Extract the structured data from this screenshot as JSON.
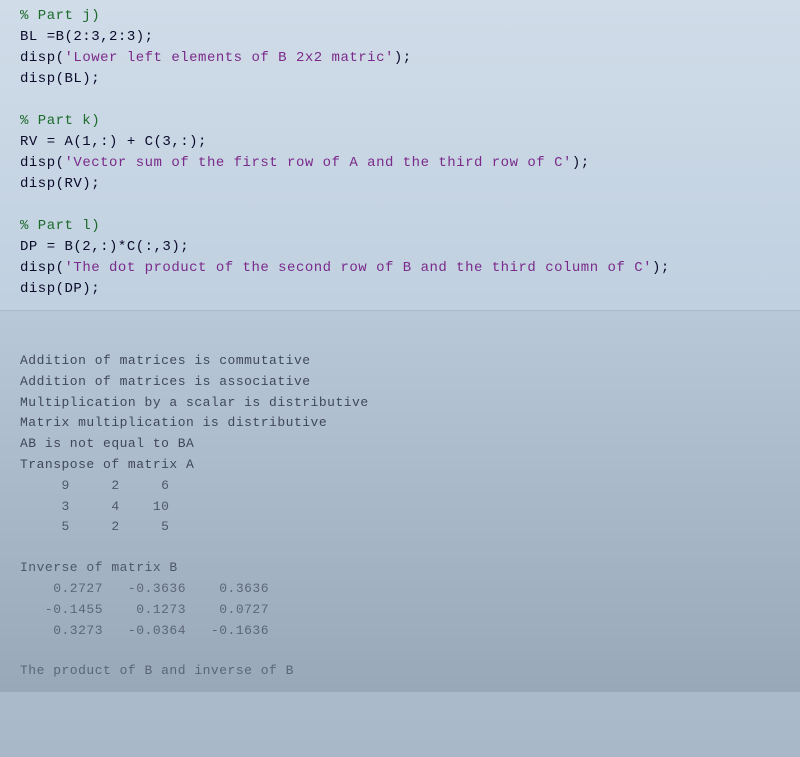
{
  "editor": {
    "part_j": {
      "comment": "% Part j)",
      "line1": "BL =B(2:3,2:3);",
      "line2_prefix": "disp(",
      "line2_string": "'Lower left elements of B 2x2 matric'",
      "line2_suffix": ");",
      "line3": "disp(BL);"
    },
    "part_k": {
      "comment": "% Part k)",
      "line1": "RV = A(1,:) + C(3,:);",
      "line2_prefix": "disp(",
      "line2_string": "'Vector sum of the first row of A and the third row of C'",
      "line2_suffix": ");",
      "line3": "disp(RV);"
    },
    "part_l": {
      "comment": "% Part l)",
      "line1": "DP = B(2,:)*C(:,3);",
      "line2_prefix": "disp(",
      "line2_string": "'The dot product of the second row of B and the third column of C'",
      "line2_suffix": ");",
      "line3": "disp(DP);"
    }
  },
  "output": {
    "lines": [
      "Addition of matrices is commutative",
      "Addition of matrices is associative",
      "Multiplication by a scalar is distributive",
      "Matrix multiplication is distributive",
      "AB is not equal to BA",
      "Transpose of matrix A"
    ],
    "matrix_a": [
      "     9     2     6",
      "     3     4    10",
      "     5     2     5"
    ],
    "inverse_label": "Inverse of matrix B",
    "matrix_b": [
      "    0.2727   -0.3636    0.3636",
      "   -0.1455    0.1273    0.0727",
      "    0.3273   -0.0364   -0.1636"
    ],
    "product_line": "The product of B and inverse of B"
  }
}
